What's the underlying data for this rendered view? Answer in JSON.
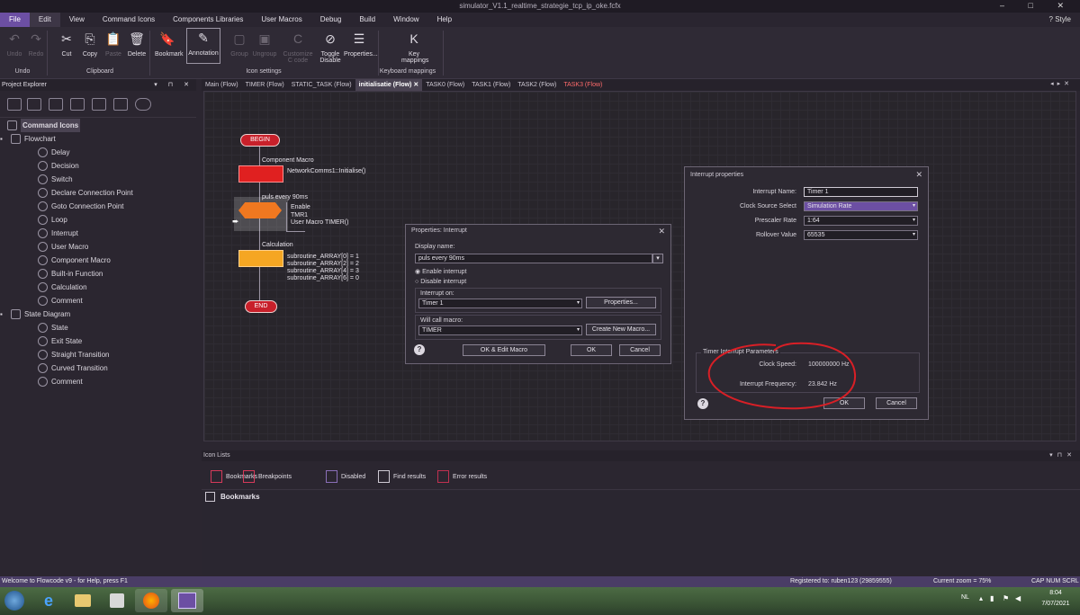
{
  "window": {
    "title": "simulator_V1.1_realtime_strategie_tcp_ip_oke.fcfx",
    "controls": "– □ ✕"
  },
  "menu": [
    "File",
    "Edit",
    "View",
    "Command Icons",
    "Components Libraries",
    "User Macros",
    "Debug",
    "Build",
    "Window",
    "Help"
  ],
  "style_label": "Style",
  "ribbon": {
    "buttons": [
      {
        "label": "Undo",
        "disabled": true
      },
      {
        "label": "Redo",
        "disabled": true
      },
      {
        "label": "Cut"
      },
      {
        "label": "Copy"
      },
      {
        "label": "Paste",
        "disabled": true
      },
      {
        "label": "Delete"
      },
      {
        "label": "Bookmark"
      },
      {
        "label": "Annotation"
      },
      {
        "label": "Group",
        "disabled": true
      },
      {
        "label": "Ungroup",
        "disabled": true
      },
      {
        "label": "Customize C code",
        "disabled": true
      },
      {
        "label": "Toggle Disable"
      },
      {
        "label": "Properties..."
      },
      {
        "label": "Key mappings"
      }
    ],
    "groups": [
      "Undo",
      "Clipboard",
      "Icon settings",
      "Keyboard mappings"
    ]
  },
  "project_explorer": {
    "title": "Project Explorer",
    "controls": "▾ ⊓ ✕",
    "tree": [
      {
        "label": "Command Icons",
        "level": 0,
        "bold": true
      },
      {
        "label": "Flowchart",
        "level": 1
      },
      {
        "label": "Delay",
        "level": 2
      },
      {
        "label": "Decision",
        "level": 2
      },
      {
        "label": "Switch",
        "level": 2
      },
      {
        "label": "Declare Connection Point",
        "level": 2
      },
      {
        "label": "Goto Connection Point",
        "level": 2
      },
      {
        "label": "Loop",
        "level": 2
      },
      {
        "label": "Interrupt",
        "level": 2
      },
      {
        "label": "User Macro",
        "level": 2
      },
      {
        "label": "Component Macro",
        "level": 2
      },
      {
        "label": "Built-in Function",
        "level": 2
      },
      {
        "label": "Calculation",
        "level": 2
      },
      {
        "label": "Comment",
        "level": 2
      },
      {
        "label": "State Diagram",
        "level": 1
      },
      {
        "label": "State",
        "level": 2
      },
      {
        "label": "Exit State",
        "level": 2
      },
      {
        "label": "Straight Transition",
        "level": 2
      },
      {
        "label": "Curved Transition",
        "level": 2
      },
      {
        "label": "Comment",
        "level": 2
      }
    ]
  },
  "tabs": [
    {
      "label": "Main (Flow)"
    },
    {
      "label": "TIMER (Flow)"
    },
    {
      "label": "STATIC_TASK (Flow)"
    },
    {
      "label": "initialisatie (Flow)",
      "active": true
    },
    {
      "label": "TASK0 (Flow)"
    },
    {
      "label": "TASK1 (Flow)"
    },
    {
      "label": "TASK2 (Flow)"
    },
    {
      "label": "TASK3 (Flow)",
      "red": true
    }
  ],
  "flowchart": {
    "begin": "BEGIN",
    "end": "END",
    "component_macro_title": "Component Macro",
    "component_macro_text": "NetworkComms1::Initialise()",
    "interrupt_title": "puls every 90ms",
    "interrupt_lines": [
      "Enable",
      "TMR1",
      "User Macro TIMER()"
    ],
    "calc_title": "Calculation",
    "calc_lines": [
      "subroutine_ARRAY[0] = 1",
      "subroutine_ARRAY[2] = 2",
      "subroutine_ARRAY[4] = 3",
      "subroutine_ARRAY[6] = 0"
    ]
  },
  "props_dialog": {
    "title": "Properties: Interrupt",
    "display_name_label": "Display name:",
    "display_name_value": "puls every 90ms",
    "enable_label": "Enable interrupt",
    "disable_label": "Disable interrupt",
    "interrupt_on_label": "Interrupt on:",
    "interrupt_on_value": "Timer 1",
    "properties_btn": "Properties...",
    "will_call_label": "Will call macro:",
    "will_call_value": "TIMER",
    "create_macro_btn": "Create New Macro...",
    "ok_edit_btn": "OK & Edit Macro",
    "ok_btn": "OK",
    "cancel_btn": "Cancel"
  },
  "int_dialog": {
    "title": "Interrupt properties",
    "name_label": "Interrupt Name:",
    "name_value": "Timer 1",
    "clock_label": "Clock Source Select",
    "clock_value": "Simulation Rate",
    "prescaler_label": "Prescaler Rate",
    "prescaler_value": "1:64",
    "rollover_label": "Rollover Value",
    "rollover_value": "65535",
    "params_title": "Timer Interrupt Parameters",
    "clock_speed_label": "Clock Speed:",
    "clock_speed_value": "100000000 Hz",
    "freq_label": "Interrupt Frequency:",
    "freq_value": "23.842 Hz",
    "ok_btn": "OK",
    "cancel_btn": "Cancel"
  },
  "icon_lists": {
    "title": "Icon Lists",
    "buttons": [
      "Bookmarks",
      "Breakpoints",
      "Disabled",
      "Find results",
      "Error results"
    ],
    "list_header": "Bookmarks"
  },
  "status": {
    "left": "Welcome to Flowcode v9 - for Help, press F1",
    "registered": "Registered to: ruben123 (29859555)",
    "zoom": "Current zoom = 75%",
    "keys": "CAP  NUM  SCRL"
  },
  "taskbar": {
    "lang": "NL",
    "time": "8:04",
    "date": "7/07/2021"
  },
  "colors": {
    "accent": "#6c4fa3",
    "annotation": "#d91f26",
    "begin_end": "#c8202a",
    "interrupt": "#f07820",
    "calc": "#f5a623",
    "macro": "#e02020"
  }
}
